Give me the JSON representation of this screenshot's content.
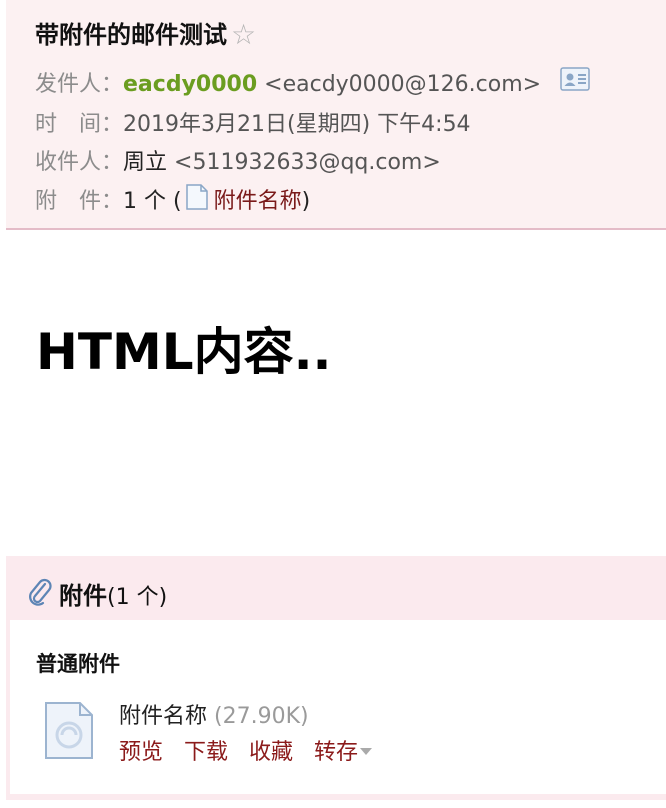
{
  "header": {
    "subject": "带附件的邮件测试",
    "star_glyph": "☆",
    "from_label": "发件人：",
    "from_name": "eacdy0000",
    "from_email": "<eacdy0000@126.com>",
    "time_label": "时　间：",
    "time_value": "2019年3月21日(星期四) 下午4:54",
    "to_label": "收件人：",
    "to_name": "周立",
    "to_email": "<511932633@qq.com>",
    "attach_label": "附　件：",
    "attach_count": "1 个 (",
    "attach_name": "附件名称",
    "attach_close": ")"
  },
  "body": {
    "content": "HTML内容.."
  },
  "attachments": {
    "title": "附件",
    "count": "(1 个)",
    "group_title": "普通附件",
    "file_name": "附件名称",
    "file_size": "(27.90K)",
    "actions": {
      "preview": "预览",
      "download": "下载",
      "favorite": "收藏",
      "save_to": "转存"
    }
  },
  "colors": {
    "header_bg": "#fcf1f2",
    "sender_name": "#6b9d20",
    "link": "#8b1a1a",
    "attachment_bg": "#fbeaee"
  },
  "icons": [
    "star-icon",
    "contact-card-icon",
    "file-icon",
    "paperclip-icon",
    "dropdown-caret-icon"
  ]
}
